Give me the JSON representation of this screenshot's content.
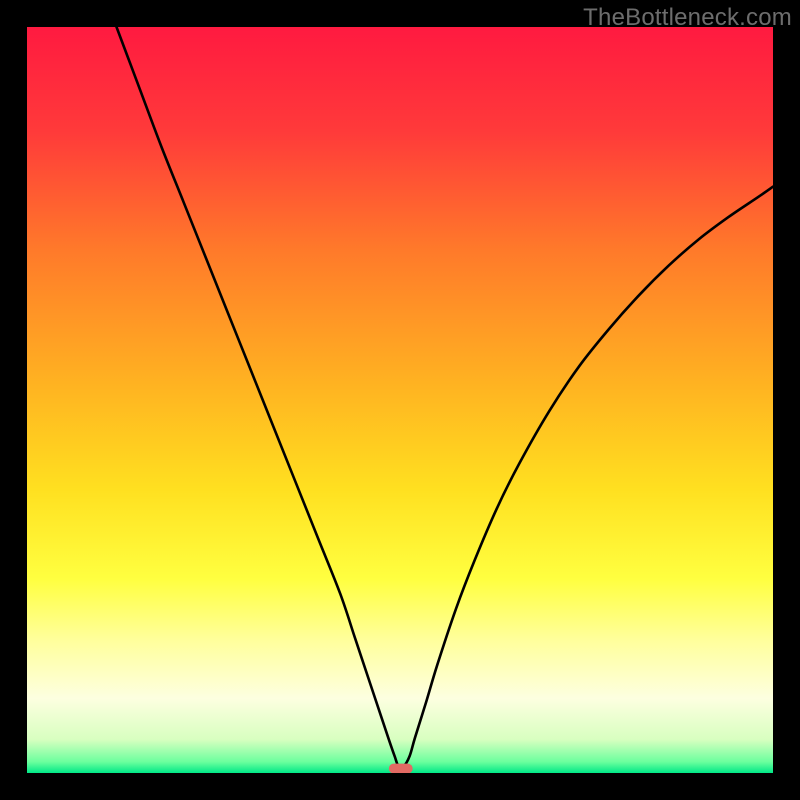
{
  "watermark": "TheBottleneck.com",
  "chart_data": {
    "type": "line",
    "title": "",
    "xlabel": "",
    "ylabel": "",
    "xlim": [
      0,
      100
    ],
    "ylim": [
      0,
      100
    ],
    "background_gradient": {
      "stops": [
        {
          "offset": 0.0,
          "color": "#ff1a40"
        },
        {
          "offset": 0.14,
          "color": "#ff3a3a"
        },
        {
          "offset": 0.3,
          "color": "#ff7a2a"
        },
        {
          "offset": 0.48,
          "color": "#ffb321"
        },
        {
          "offset": 0.62,
          "color": "#ffe020"
        },
        {
          "offset": 0.74,
          "color": "#ffff40"
        },
        {
          "offset": 0.82,
          "color": "#ffff9a"
        },
        {
          "offset": 0.9,
          "color": "#fdffe0"
        },
        {
          "offset": 0.955,
          "color": "#d8ffc0"
        },
        {
          "offset": 0.985,
          "color": "#6cff9e"
        },
        {
          "offset": 1.0,
          "color": "#00e887"
        }
      ]
    },
    "series": [
      {
        "name": "bottleneck-curve",
        "x": [
          12.0,
          15,
          18,
          21,
          24,
          27,
          30,
          33,
          36,
          39,
          42,
          44,
          46,
          47.5,
          48.5,
          49.3,
          49.8,
          50.5,
          51.3,
          52.0,
          53.5,
          55.0,
          57.5,
          60,
          63,
          66,
          70,
          74,
          78,
          82,
          86,
          90,
          94,
          98,
          100
        ],
        "y": [
          100.0,
          92,
          84,
          76.5,
          69,
          61.5,
          54,
          46.5,
          39,
          31.5,
          24,
          18,
          12,
          7.5,
          4.5,
          2.2,
          0.9,
          0.9,
          2.3,
          4.7,
          9.5,
          14.5,
          22,
          28.5,
          35.5,
          41.5,
          48.5,
          54.5,
          59.5,
          64,
          68,
          71.5,
          74.5,
          77.2,
          78.6
        ]
      }
    ],
    "marker": {
      "name": "optimal-marker",
      "x": 50.1,
      "y": 0.6,
      "width": 3.2,
      "height": 1.3,
      "color": "#e26a63"
    }
  }
}
